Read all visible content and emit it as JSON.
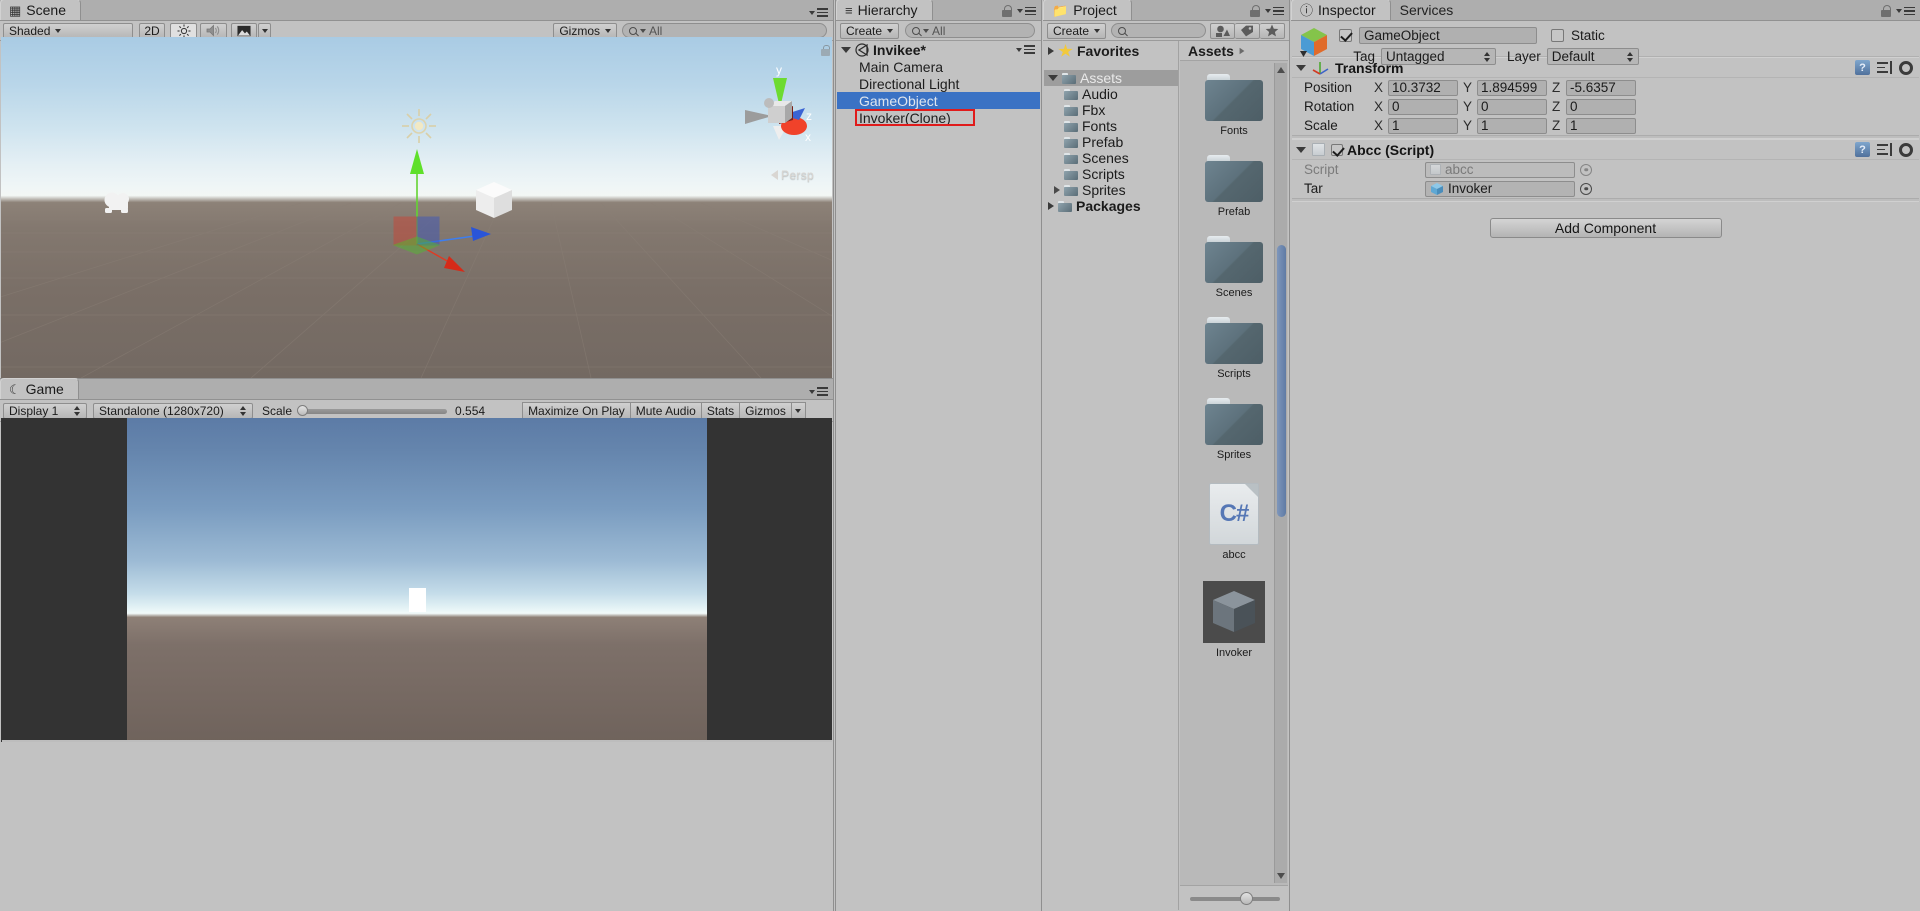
{
  "scene_view": {
    "tab_label": "Scene",
    "tab_icon": "grid-icon",
    "shading_mode": "Shaded",
    "mode_2d": "2D",
    "lighting_icon": "sun-icon",
    "audio_icon": "speaker-icon",
    "fx_icon": "image-icon",
    "gizmos_label": "Gizmos",
    "search_placeholder": "All",
    "search_value": "",
    "perspective_label": "Persp",
    "gizmo_axes": {
      "y": "y",
      "x": "x",
      "z": "z"
    },
    "sky_color": "#a9cbe4",
    "ground_color": "#7a6f67"
  },
  "game_view": {
    "tab_label": "Game",
    "tab_icon": "gamepad-icon",
    "display": "Display 1",
    "aspect": "Standalone (1280x720)",
    "scale_label": "Scale",
    "scale_value": "0.554",
    "maximize_on_play": "Maximize On Play",
    "mute_audio": "Mute Audio",
    "stats": "Stats",
    "gizmos": "Gizmos"
  },
  "hierarchy": {
    "tab_label": "Hierarchy",
    "tab_icon": "list-icon",
    "create_label": "Create",
    "search_placeholder": "All",
    "search_value": "",
    "scene_name": "Invikee*",
    "items": [
      {
        "label": "Main Camera",
        "selected": false,
        "highlighted": false
      },
      {
        "label": "Directional Light",
        "selected": false,
        "highlighted": false
      },
      {
        "label": "GameObject",
        "selected": true,
        "highlighted": false
      },
      {
        "label": "Invoker(Clone)",
        "selected": false,
        "highlighted": true
      }
    ],
    "highlight_color": "#e01b1b",
    "selection_color": "#3a72c4"
  },
  "project": {
    "tab_label": "Project",
    "tab_icon": "folder-icon",
    "create_label": "Create",
    "search_placeholder": "",
    "search_value": "",
    "toolbar_icons": [
      "filter-type-icon",
      "filter-label-icon",
      "favorite-star-icon"
    ],
    "breadcrumb": "Assets",
    "tree": [
      {
        "label": "Favorites",
        "depth": 0,
        "bold": true,
        "icon": "star-icon",
        "arrow": "collapsed",
        "selected": false
      },
      {
        "label": "Assets",
        "depth": 0,
        "bold": false,
        "icon": "folder-icon",
        "arrow": "expanded",
        "selected": true
      },
      {
        "label": "Audio",
        "depth": 1,
        "bold": false,
        "icon": "folder-icon",
        "arrow": "none",
        "selected": false
      },
      {
        "label": "Fbx",
        "depth": 1,
        "bold": false,
        "icon": "folder-icon",
        "arrow": "none",
        "selected": false
      },
      {
        "label": "Fonts",
        "depth": 1,
        "bold": false,
        "icon": "folder-icon",
        "arrow": "none",
        "selected": false
      },
      {
        "label": "Prefab",
        "depth": 1,
        "bold": false,
        "icon": "folder-icon",
        "arrow": "none",
        "selected": false
      },
      {
        "label": "Scenes",
        "depth": 1,
        "bold": false,
        "icon": "folder-icon",
        "arrow": "none",
        "selected": false
      },
      {
        "label": "Scripts",
        "depth": 1,
        "bold": false,
        "icon": "folder-icon",
        "arrow": "none",
        "selected": false
      },
      {
        "label": "Sprites",
        "depth": 1,
        "bold": false,
        "icon": "folder-icon",
        "arrow": "collapsed",
        "selected": false
      },
      {
        "label": "Packages",
        "depth": 0,
        "bold": true,
        "icon": "folder-icon",
        "arrow": "collapsed",
        "selected": false
      }
    ],
    "assets": [
      {
        "label": "Fonts",
        "type": "folder"
      },
      {
        "label": "Prefab",
        "type": "folder"
      },
      {
        "label": "Scenes",
        "type": "folder"
      },
      {
        "label": "Scripts",
        "type": "folder"
      },
      {
        "label": "Sprites",
        "type": "folder"
      },
      {
        "label": "abcc",
        "type": "csharp"
      },
      {
        "label": "Invoker",
        "type": "prefab-cube"
      }
    ]
  },
  "inspector": {
    "tab_label": "Inspector",
    "tab_icon": "info-icon",
    "tab_services": "Services",
    "object_enabled": true,
    "object_name": "GameObject",
    "static_label": "Static",
    "static_checked": false,
    "tag_label": "Tag",
    "tag_value": "Untagged",
    "layer_label": "Layer",
    "layer_value": "Default",
    "transform": {
      "title": "Transform",
      "icon": "transform-axis-icon",
      "rows": [
        {
          "label": "Position",
          "x": "10.3732",
          "y": "1.894599",
          "z": "-5.6357"
        },
        {
          "label": "Rotation",
          "x": "0",
          "y": "0",
          "z": "0"
        },
        {
          "label": "Scale",
          "x": "1",
          "y": "1",
          "z": "1"
        }
      ],
      "axis_labels": {
        "x": "X",
        "y": "Y",
        "z": "Z"
      }
    },
    "script_component": {
      "title": "Abcc (Script)",
      "enabled": true,
      "icon": "script-icon",
      "fields": [
        {
          "label": "Script",
          "value": "abcc",
          "readonly": true,
          "icon": "script-file-icon"
        },
        {
          "label": "Tar",
          "value": "Invoker",
          "readonly": false,
          "icon": "prefab-cube-icon"
        }
      ]
    },
    "add_component_label": "Add Component"
  }
}
